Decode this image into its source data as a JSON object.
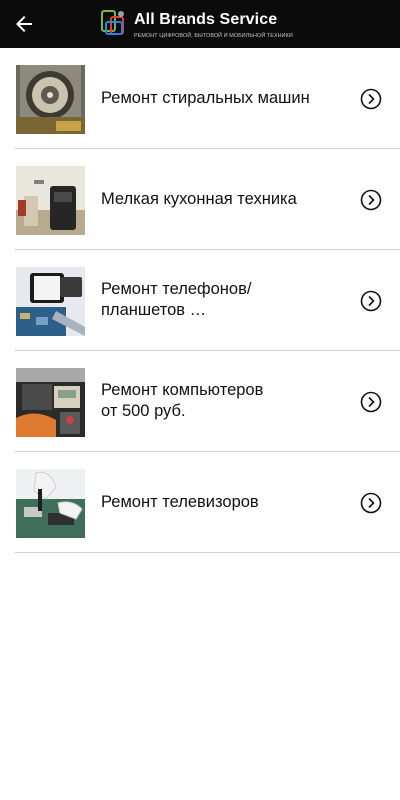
{
  "header": {
    "brand_name": "All Brands Service",
    "brand_tagline": "РЕМОНТ ЦИФРОВОЙ, БЫТОВОЙ И МОБИЛЬНОЙ ТЕХНИКИ",
    "back_icon": "arrow-left-icon"
  },
  "items": [
    {
      "label": "Ремонт стиральных машин",
      "thumb": "washing-machine-photo"
    },
    {
      "label": "Мелкая кухонная техника",
      "thumb": "kitchen-appliance-photo"
    },
    {
      "label": "Ремонт телефонов/\nпланшетов …",
      "thumb": "phone-repair-photo"
    },
    {
      "label": "Ремонт компьютеров\nот 500 руб.",
      "thumb": "computer-repair-photo"
    },
    {
      "label": "Ремонт телевизоров",
      "thumb": "tv-repair-photo"
    }
  ],
  "colors": {
    "topbar": "#0b0b0b",
    "divider": "#cfcfcf",
    "text": "#111111"
  }
}
